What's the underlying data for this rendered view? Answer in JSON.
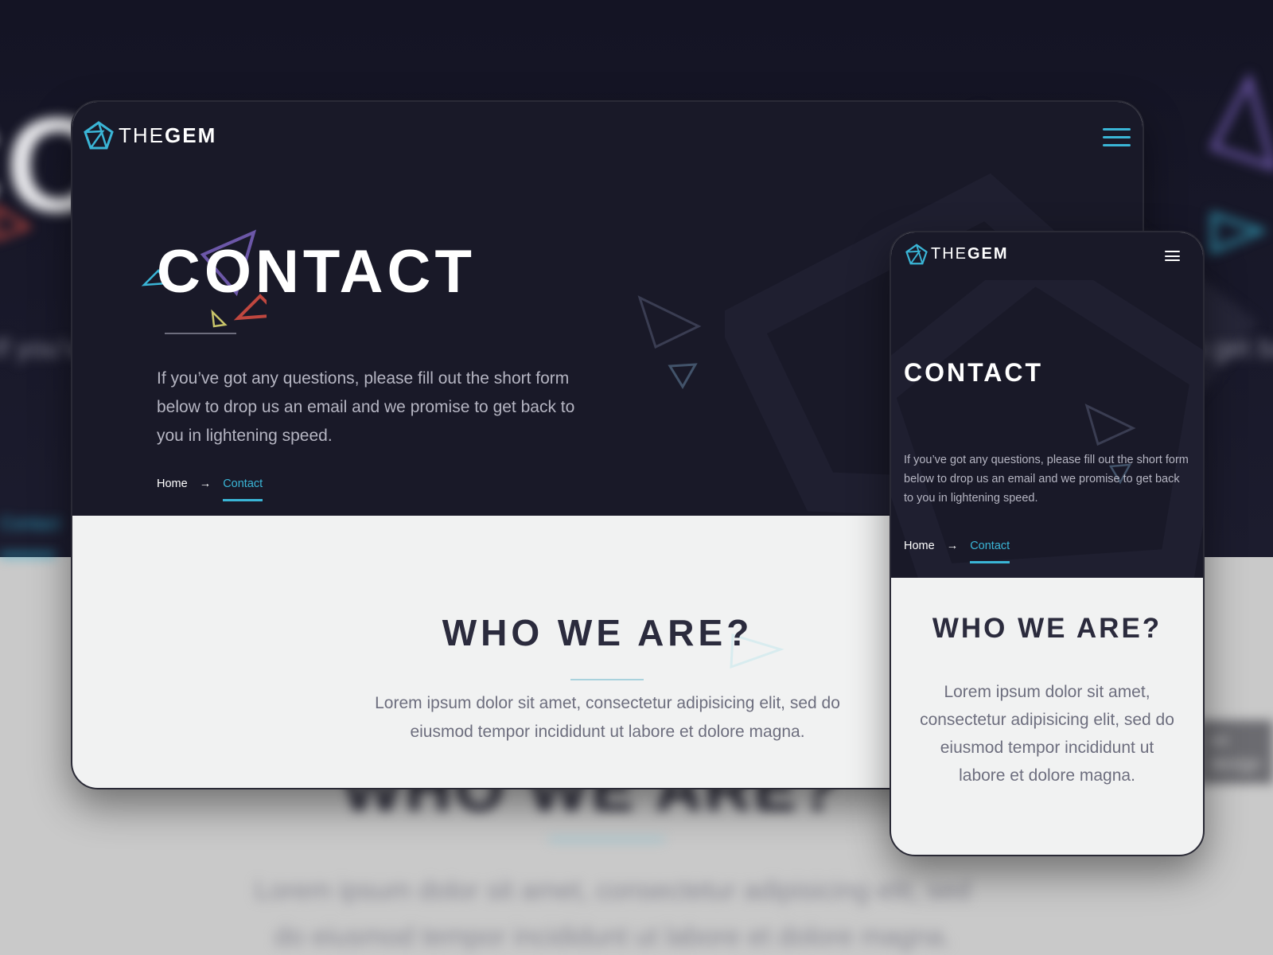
{
  "brand": {
    "logo_light": "THE",
    "logo_bold": "GEM",
    "accent": "#3ab5d6",
    "dark_bg": "#191928",
    "light_bg": "#f1f2f2"
  },
  "hero": {
    "title": "CONTACT",
    "intro": "If you’ve got any questions, please fill out the short form below to drop us an email and we promise to get back to you in lightening speed.",
    "breadcrumb": {
      "home": "Home",
      "arrow": "→",
      "current": "Contact"
    }
  },
  "section": {
    "heading": "WHO WE ARE?",
    "body": "Lorem ipsum dolor sit amet, consectetur adipisicing elit, sed do eiusmod tempor incididunt ut labore et dolore magna."
  },
  "icons": {
    "logo": "gem-pentagon-icon",
    "menu": "hamburger-menu-icon"
  }
}
